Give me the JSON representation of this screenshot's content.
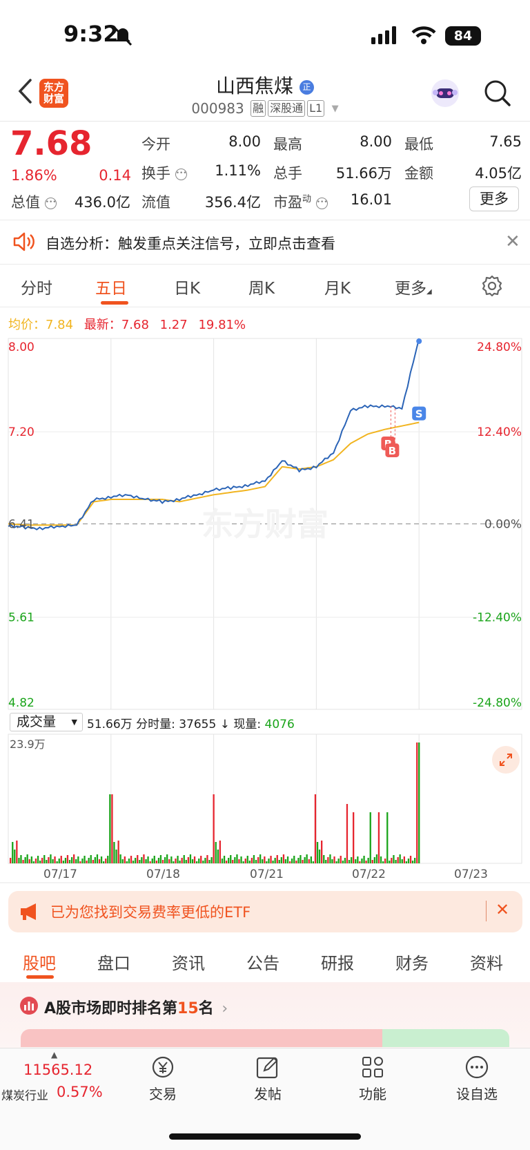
{
  "status": {
    "time": "9:32",
    "battery": "84"
  },
  "header": {
    "logo_line1": "东方",
    "logo_line2": "财富",
    "title": "山西焦煤",
    "title_badge": "正",
    "code": "000983",
    "tags": [
      "融",
      "深股通",
      "L1"
    ]
  },
  "quote": {
    "price": "7.68",
    "change_pct": "1.86%",
    "change": "0.14",
    "open_label": "今开",
    "open": "8.00",
    "high_label": "最高",
    "high": "8.00",
    "low_label": "最低",
    "low": "7.65",
    "turnover_label": "换手",
    "turnover": "1.11%",
    "volume_label": "总手",
    "volume": "51.66万",
    "amount_label": "金额",
    "amount": "4.05亿",
    "mktcap_label": "总值",
    "mktcap": "436.0亿",
    "float_label": "流值",
    "float": "356.4亿",
    "pe_label": "市盈",
    "pe_sup": "动",
    "pe": "16.01",
    "more": "更多"
  },
  "notice": {
    "text": "自选分析：触发重点关注信号，立即点击查看"
  },
  "chart_tabs": [
    "分时",
    "五日",
    "日K",
    "周K",
    "月K",
    "更多"
  ],
  "legend": {
    "avg_label": "均价：",
    "avg": "7.84",
    "last_label": "最新：",
    "last": "7.68",
    "diff": "1.27",
    "pct": "19.81%"
  },
  "chart_data": {
    "type": "line",
    "title": "",
    "x_categories": [
      "07/17",
      "07/18",
      "07/21",
      "07/22",
      "07/23"
    ],
    "price_ticks": [
      "8.00",
      "7.20",
      "6.41",
      "5.61",
      "4.82"
    ],
    "pct_ticks": [
      "24.80%",
      "12.40%",
      "0.00%",
      "-12.40%",
      "-24.80%"
    ],
    "ylim": [
      4.82,
      8.0
    ],
    "prev_close": 6.41,
    "series": [
      {
        "values": [
          6.39,
          6.38,
          6.37,
          6.39,
          6.4,
          6.62,
          6.64,
          6.66,
          6.62,
          6.6,
          6.62,
          6.66,
          6.7,
          6.72,
          6.74,
          6.78,
          6.95,
          6.87,
          6.9,
          7.02,
          7.38,
          7.42,
          7.42,
          7.4,
          8.0
        ]
      },
      {
        "values": [
          6.41,
          6.4,
          6.4,
          6.4,
          6.4,
          6.6,
          6.62,
          6.62,
          6.62,
          6.62,
          6.6,
          6.63,
          6.66,
          6.68,
          6.7,
          6.73,
          6.9,
          6.88,
          6.9,
          6.96,
          7.1,
          7.18,
          7.22,
          7.25,
          7.28
        ]
      }
    ],
    "markers": [
      "S",
      "B",
      "B"
    ],
    "volume": {
      "label": "成交量",
      "total": "51.66万",
      "minute_label": "分时量:",
      "minute": "37655",
      "current_label": "现量:",
      "current": "4076",
      "ytick": "23.9万"
    }
  },
  "etf": {
    "text": "已为您找到交易费率更低的ETF"
  },
  "bottom_tabs": [
    "股吧",
    "盘口",
    "资讯",
    "公告",
    "研报",
    "财务",
    "资料"
  ],
  "rank": {
    "prefix": "A股市场即时排名第",
    "num": "15",
    "suffix": "名"
  },
  "bottom_nav": {
    "index_value": "11565.12",
    "index_name": "煤炭行业",
    "index_pct": "0.57%",
    "items": [
      "交易",
      "发帖",
      "功能",
      "设自选"
    ]
  },
  "colors": {
    "up": "#e6252f",
    "down": "#1aa41a",
    "brand": "#f0531f",
    "price_line": "#2a63b6",
    "avg_line": "#f1b41f"
  }
}
